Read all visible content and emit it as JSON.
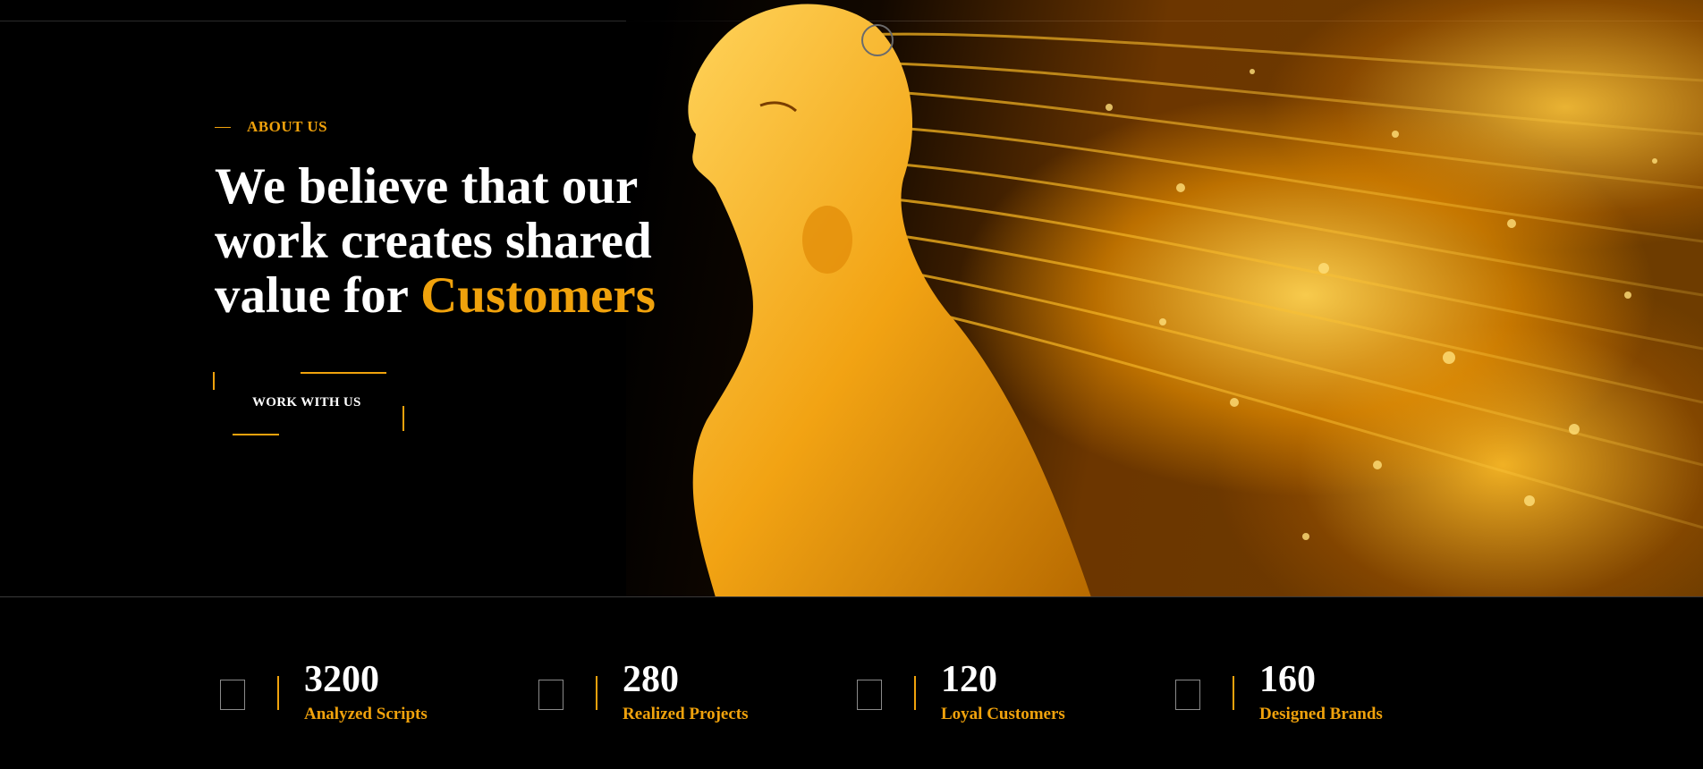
{
  "hero": {
    "section_label": "ABOUT US",
    "headline_part1": "We believe that our work creates shared value for ",
    "headline_accent": "Customers",
    "cta_label": "WORK WITH US"
  },
  "stats": [
    {
      "icon": "generic-square-icon",
      "value": "3200",
      "label": "Analyzed Scripts"
    },
    {
      "icon": "generic-square-icon",
      "value": "280",
      "label": "Realized Projects"
    },
    {
      "icon": "generic-square-icon",
      "value": "120",
      "label": "Loyal Customers"
    },
    {
      "icon": "generic-square-icon",
      "value": "160",
      "label": "Designed Brands"
    }
  ],
  "colors": {
    "accent": "#f0a20c",
    "background": "#000000",
    "text": "#ffffff"
  }
}
